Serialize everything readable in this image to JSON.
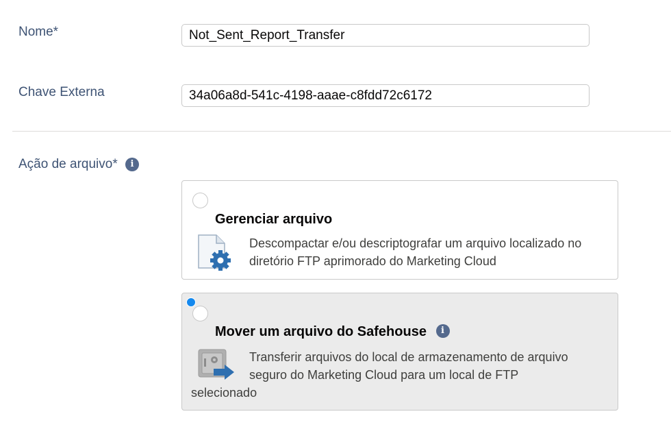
{
  "form": {
    "name": {
      "label": "Nome*",
      "value": "Not_Sent_Report_Transfer"
    },
    "external_key": {
      "label": "Chave Externa",
      "value": "34a06a8d-541c-4198-aaae-c8fdd72c6172"
    },
    "file_action": {
      "label": "Ação de arquivo*",
      "info_icon": "i",
      "options": [
        {
          "title": "Gerenciar arquivo",
          "description": "Descompactar e/ou descriptografar um arquivo localizado no diretório FTP aprimorado do Marketing Cloud",
          "icon": "file-gear-icon",
          "selected": false
        },
        {
          "title": "Mover um arquivo do Safehouse",
          "info_icon": "i",
          "description_line1": "Transferir arquivos do local de armazenamento de arquivo",
          "description_line2": "seguro do Marketing Cloud para um local de FTP",
          "description_line3": "selecionado",
          "icon": "safe-transfer-icon",
          "selected": true
        }
      ]
    }
  },
  "colors": {
    "label": "#3e5374",
    "info_icon": "#54698d",
    "radio_selected": "#1589ee",
    "card_selected_bg": "#ebebeb",
    "gear": "#2e6fb0"
  }
}
